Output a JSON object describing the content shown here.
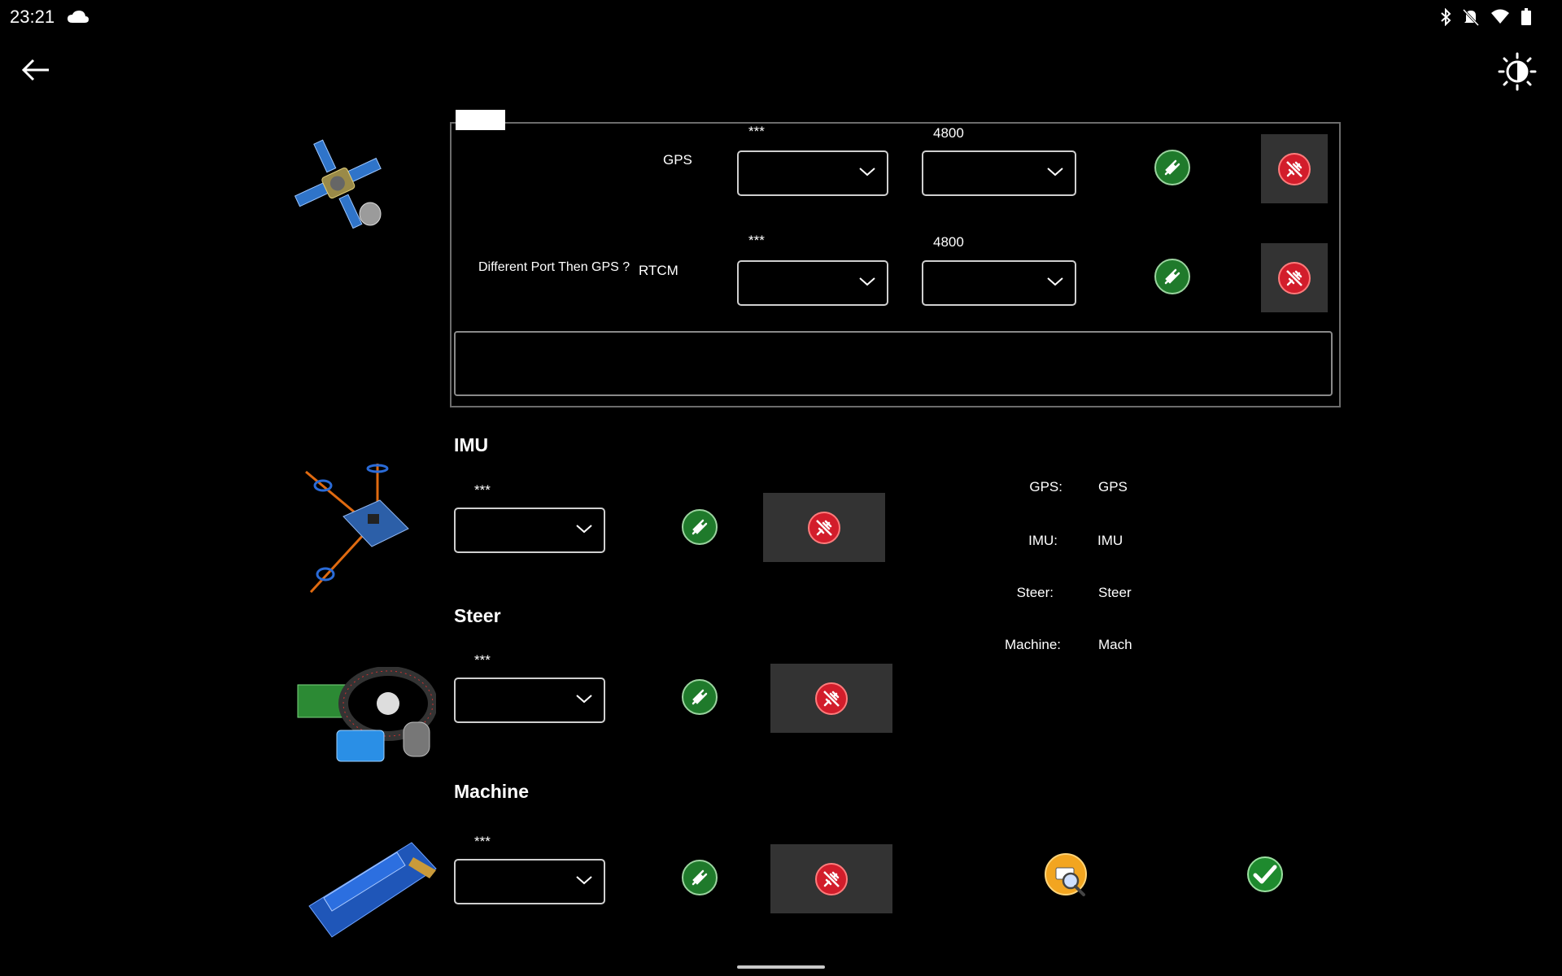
{
  "status_bar": {
    "time": "23:21"
  },
  "frame": {
    "rows": [
      {
        "label": "GPS",
        "port_header": "***",
        "baud_header": "4800"
      },
      {
        "label": "RTCM",
        "prefix": "Different Port Then GPS ?",
        "port_header": "***",
        "baud_header": "4800"
      }
    ]
  },
  "imu": {
    "title": "IMU",
    "port_header": "***"
  },
  "steer": {
    "title": "Steer",
    "port_header": "***"
  },
  "machine": {
    "title": "Machine",
    "port_header": "***"
  },
  "summary": [
    {
      "key": "GPS:",
      "value": "GPS"
    },
    {
      "key": "IMU:",
      "value": "IMU"
    },
    {
      "key": "Steer:",
      "value": "Steer"
    },
    {
      "key": "Machine:",
      "value": "Mach"
    }
  ]
}
